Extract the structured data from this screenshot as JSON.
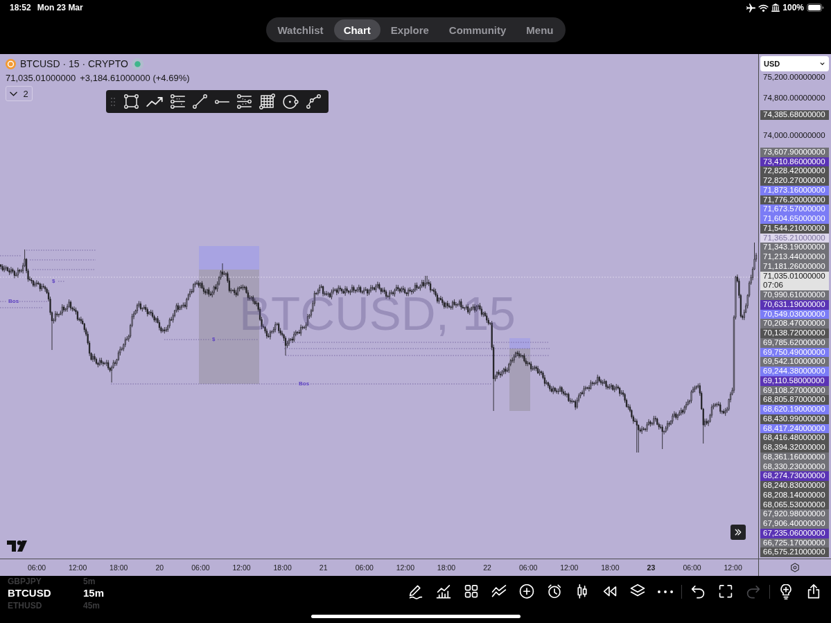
{
  "status_bar": {
    "time": "18:52",
    "date": "Mon 23 Mar",
    "battery": "100%"
  },
  "nav_tabs": [
    {
      "label": "Watchlist",
      "selected": false
    },
    {
      "label": "Chart",
      "selected": true
    },
    {
      "label": "Explore",
      "selected": false
    },
    {
      "label": "Community",
      "selected": false
    },
    {
      "label": "Menu",
      "selected": false
    }
  ],
  "legend": {
    "symbol": "BTCUSD · 15 · CRYPTO",
    "price": "71,035.01000000",
    "change": "+3,184.61000000 (+4.69%)",
    "indicators": "2"
  },
  "chart": {
    "watermark": "BTCUSD, 15",
    "level_labels": [
      {
        "text": "$"
      },
      {
        "text": "Bos"
      },
      {
        "text": "$"
      },
      {
        "text": "Bos"
      }
    ]
  },
  "price_axis": {
    "currency": "USD",
    "labels": [
      {
        "kind": "tick",
        "text": "75,200.00000000"
      },
      {
        "kind": "tick",
        "text": "74,800.00000000"
      },
      {
        "kind": "badge",
        "text": "74,385.68000000",
        "color": "#545454"
      },
      {
        "kind": "tick",
        "text": "74,000.00000000"
      },
      {
        "kind": "badge",
        "text": "73,607.90000000",
        "color": "#717177"
      },
      {
        "kind": "badge",
        "text": "73,410.86000000",
        "color": "#5a33b5"
      },
      {
        "kind": "badge",
        "text": "72,828.42000000",
        "color": "#545454"
      },
      {
        "kind": "badge",
        "text": "72,820.27000000",
        "color": "#545454"
      },
      {
        "kind": "badge",
        "text": "71,873.16000000",
        "color": "#7b7cf6"
      },
      {
        "kind": "badge",
        "text": "71,776.20000000",
        "color": "#545454"
      },
      {
        "kind": "badge",
        "text": "71,673.57000000",
        "color": "#7b7cf6"
      },
      {
        "kind": "badge",
        "text": "71,604.65000000",
        "color": "#7b7cf6"
      },
      {
        "kind": "badge",
        "text": "71,544.21000000",
        "color": "#545454"
      },
      {
        "kind": "faded",
        "text": "71,365.21000000",
        "color": "#ddd7ec"
      },
      {
        "kind": "badge",
        "text": "71,343.19000000",
        "color": "#717177"
      },
      {
        "kind": "badge",
        "text": "71,213.44000000",
        "color": "#717177"
      },
      {
        "kind": "badge",
        "text": "71,181.26000000",
        "color": "#717177"
      },
      {
        "kind": "current",
        "text": "71,035.01000000",
        "countdown": "07:06",
        "color": "#e2e2e2"
      },
      {
        "kind": "badge",
        "text": "70,990.61000000",
        "color": "#717177"
      },
      {
        "kind": "badge",
        "text": "70,631.19000000",
        "color": "#5a33b5"
      },
      {
        "kind": "badge",
        "text": "70,549.03000000",
        "color": "#7b7cf6"
      },
      {
        "kind": "badge",
        "text": "70,208.47000000",
        "color": "#717177"
      },
      {
        "kind": "badge",
        "text": "70,138.72000000",
        "color": "#545454"
      },
      {
        "kind": "badge",
        "text": "69,785.62000000",
        "color": "#717177"
      },
      {
        "kind": "badge",
        "text": "69,750.49000000",
        "color": "#7b7cf6"
      },
      {
        "kind": "badge",
        "text": "69,542.10000000",
        "color": "#717177"
      },
      {
        "kind": "badge",
        "text": "69,244.38000000",
        "color": "#7b7cf6"
      },
      {
        "kind": "badge",
        "text": "69,110.58000000",
        "color": "#5a33b5"
      },
      {
        "kind": "badge",
        "text": "69,108.27000000",
        "color": "#717177"
      },
      {
        "kind": "badge",
        "text": "68,805.87000000",
        "color": "#545454"
      },
      {
        "kind": "badge",
        "text": "68,620.19000000",
        "color": "#7b7cf6"
      },
      {
        "kind": "badge",
        "text": "68,430.99000000",
        "color": "#545454"
      },
      {
        "kind": "badge",
        "text": "68,417.24000000",
        "color": "#7b7cf6"
      },
      {
        "kind": "badge",
        "text": "68,416.48000000",
        "color": "#545454"
      },
      {
        "kind": "badge",
        "text": "68,394.32000000",
        "color": "#545454"
      },
      {
        "kind": "badge",
        "text": "68,361.16000000",
        "color": "#717177"
      },
      {
        "kind": "badge",
        "text": "68,330.23000000",
        "color": "#717177"
      },
      {
        "kind": "badge",
        "text": "68,274.73000000",
        "color": "#5a33b5"
      },
      {
        "kind": "badge",
        "text": "68,240.83000000",
        "color": "#545454"
      },
      {
        "kind": "badge",
        "text": "68,208.14000000",
        "color": "#545454"
      },
      {
        "kind": "badge",
        "text": "68,065.53000000",
        "color": "#545454"
      },
      {
        "kind": "badge",
        "text": "67,920.98000000",
        "color": "#717177"
      },
      {
        "kind": "badge",
        "text": "67,906.40000000",
        "color": "#717177"
      },
      {
        "kind": "badge",
        "text": "67,235.06000000",
        "color": "#5a33b5"
      },
      {
        "kind": "badge",
        "text": "66,725.17000000",
        "color": "#717177"
      },
      {
        "kind": "badge",
        "text": "66,575.21000000",
        "color": "#545454"
      }
    ]
  },
  "time_axis": [
    {
      "text": "06:00",
      "bold": false
    },
    {
      "text": "12:00",
      "bold": false
    },
    {
      "text": "18:00",
      "bold": false
    },
    {
      "text": "20",
      "bold": false
    },
    {
      "text": "06:00",
      "bold": false
    },
    {
      "text": "12:00",
      "bold": false
    },
    {
      "text": "18:00",
      "bold": false
    },
    {
      "text": "21",
      "bold": false
    },
    {
      "text": "06:00",
      "bold": false
    },
    {
      "text": "12:00",
      "bold": false
    },
    {
      "text": "18:00",
      "bold": false
    },
    {
      "text": "22",
      "bold": false
    },
    {
      "text": "06:00",
      "bold": false
    },
    {
      "text": "12:00",
      "bold": false
    },
    {
      "text": "18:00",
      "bold": false
    },
    {
      "text": "23",
      "bold": true
    },
    {
      "text": "06:00",
      "bold": false
    },
    {
      "text": "12:00",
      "bold": false
    }
  ],
  "symbol_picker": [
    {
      "label": "GBPJPY",
      "selected": false
    },
    {
      "label": "BTCUSD",
      "selected": true
    },
    {
      "label": "ETHUSD",
      "selected": false
    }
  ],
  "interval_picker": [
    {
      "label": "5m",
      "selected": false
    },
    {
      "label": "15m",
      "selected": true
    },
    {
      "label": "45m",
      "selected": false
    }
  ],
  "undo": {
    "disabled": false
  },
  "redo": {
    "disabled": true
  }
}
